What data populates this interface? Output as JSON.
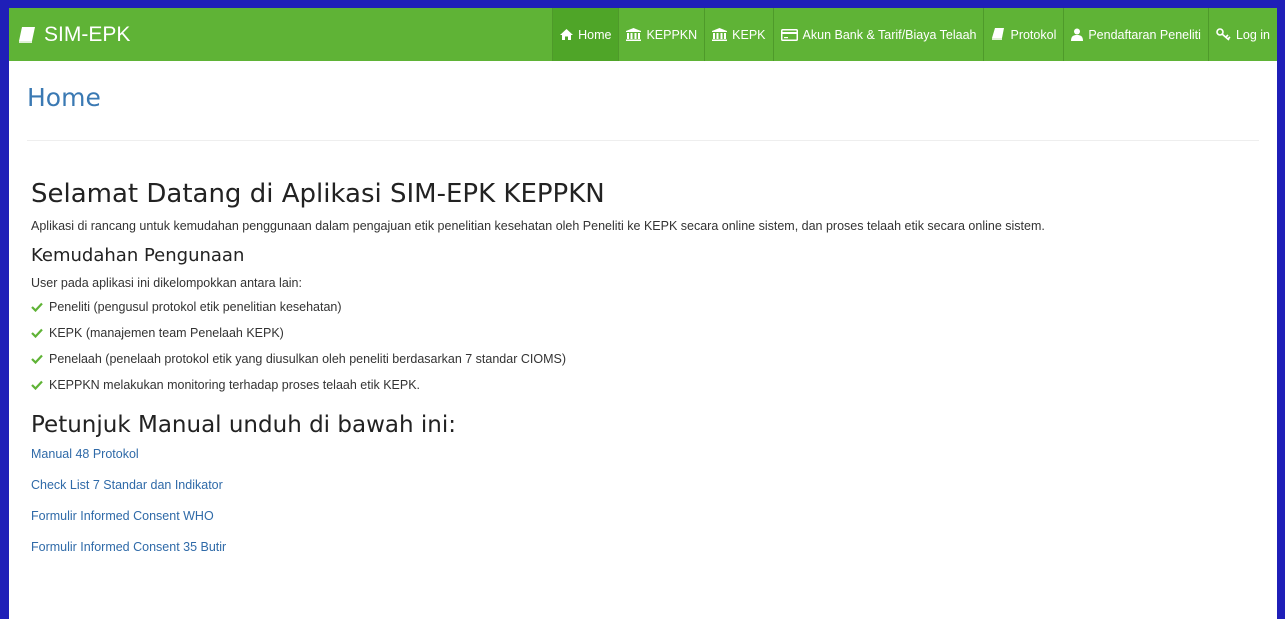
{
  "navbar": {
    "brand": "SIM-EPK",
    "items": [
      {
        "label": "Home",
        "icon": "home-icon"
      },
      {
        "label": "KEPPKN",
        "icon": "institution-icon"
      },
      {
        "label": "KEPK",
        "icon": "institution-icon"
      },
      {
        "label": "Akun Bank & Tarif/Biaya Telaah",
        "icon": "credit-card-icon"
      },
      {
        "label": "Protokol",
        "icon": "book-icon"
      },
      {
        "label": "Pendaftaran Peneliti",
        "icon": "user-icon"
      },
      {
        "label": "Log in",
        "icon": "key-icon"
      }
    ]
  },
  "page": {
    "title": "Home"
  },
  "main": {
    "welcome": "Selamat Datang di Aplikasi SIM-EPK KEPPKN",
    "intro": "Aplikasi di rancang untuk kemudahan penggunaan dalam pengajuan etik penelitian kesehatan oleh Peneliti ke KEPK secara online sistem, dan proses telaah etik secara online sistem.",
    "ease_heading": "Kemudahan Pengunaan",
    "users_intro": "User pada aplikasi ini dikelompokkan antara lain:",
    "users": [
      "Peneliti (pengusul protokol etik penelitian kesehatan)",
      "KEPK (manajemen team Penelaah KEPK)",
      "Penelaah (penelaah protokol etik yang diusulkan oleh peneliti berdasarkan 7 standar CIOMS)",
      "KEPPKN melakukan monitoring terhadap proses telaah etik KEPK."
    ],
    "manual_heading": "Petunjuk Manual unduh di bawah ini:",
    "manuals": [
      "Manual 48 Protokol",
      "Check List 7 Standar dan Indikator",
      "Formulir Informed Consent WHO",
      "Formulir Informed Consent 35 Butir"
    ]
  },
  "colors": {
    "navbar": "#5fb336",
    "link": "#2f6aa8",
    "title": "#3a79b3",
    "check": "#5fb336",
    "border": "#1f1fb8"
  }
}
